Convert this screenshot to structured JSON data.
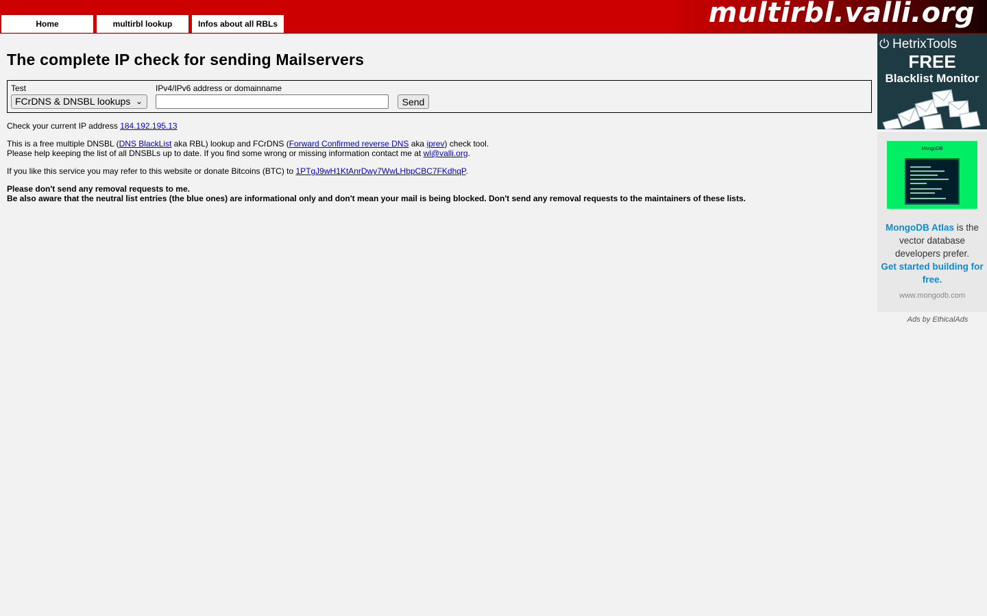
{
  "header": {
    "nav": [
      {
        "label": "Home"
      },
      {
        "label": "multirbl lookup"
      },
      {
        "label": "Infos about all RBLs"
      }
    ],
    "logo": "multirbl.valli.org"
  },
  "main": {
    "title": "The complete IP check for sending Mailservers",
    "form": {
      "test_label": "Test",
      "test_value": "FCrDNS & DNSBL lookups",
      "address_label": "IPv4/IPv6 address or domainname",
      "address_value": "",
      "send_label": "Send"
    },
    "ip_check": {
      "text": "Check your current IP address ",
      "ip": "184.192.195.13"
    },
    "intro": {
      "t1": "This is a free multiple DNSBL (",
      "l1": "DNS BlackList",
      "t2": " aka RBL) lookup and FCrDNS (",
      "l2": "Forward Confirmed reverse DNS",
      "t3": " aka ",
      "l3": "iprev",
      "t4": ") check tool.",
      "t5": "Please help keeping the list of all DNSBLs up to date. If you find some wrong or missing information contact me at ",
      "email": "wl@valli.org",
      "t6": "."
    },
    "donate": {
      "text": "If you like this service you may refer to this website or donate Bitcoins (BTC) to ",
      "btc": "1PTgJ9wH1KtAnrDwy7WwLHbpCBC7FKdhqP",
      "end": "."
    },
    "notice": {
      "line1": "Please don't send any removal requests to me.",
      "line2": "Be also aware that the neutral list entries (the blue ones) are informational only and don't mean your mail is being blocked. Don't send any removal requests to the maintainers of these lists."
    }
  },
  "ads": {
    "hetrix": {
      "brand": "HetrixTools",
      "free": "FREE",
      "product": "Blacklist Monitor"
    },
    "mongodb": {
      "img_brand": "MongoDB",
      "headline": "MongoDB Atlas",
      "text1": " is the vector database developers prefer.",
      "cta": "Get started building for free.",
      "url": "www.mongodb.com"
    },
    "ethical": "Ads by EthicalAds"
  }
}
